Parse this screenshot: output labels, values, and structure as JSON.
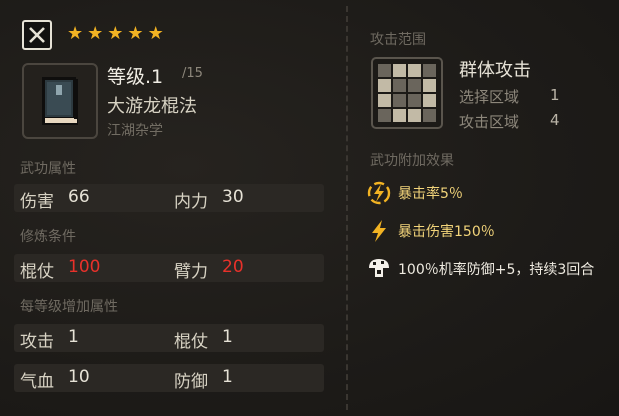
{
  "header": {
    "close_icon": "close-icon",
    "stars": [
      "★",
      "★",
      "★",
      "★",
      "★"
    ]
  },
  "skill": {
    "level": "等级.1",
    "level_max": "/15",
    "name": "大游龙棍法",
    "category": "江湖杂学"
  },
  "sections": {
    "attributes": "武功属性",
    "requirements": "修炼条件",
    "per_level": "每等级增加属性",
    "range": "攻击范围",
    "extra_effects": "武功附加效果"
  },
  "attributes": [
    {
      "label": "伤害",
      "value": "66"
    },
    {
      "label": "内力",
      "value": "30"
    }
  ],
  "requirements": [
    {
      "label": "棍仗",
      "value": "100"
    },
    {
      "label": "臂力",
      "value": "20"
    }
  ],
  "per_level": [
    {
      "label": "攻击",
      "value": "1"
    },
    {
      "label": "棍仗",
      "value": "1"
    },
    {
      "label": "气血",
      "value": "10"
    },
    {
      "label": "防御",
      "value": "1"
    }
  ],
  "range": {
    "type": "群体攻击",
    "select_label": "选择区域",
    "select_value": "1",
    "attack_label": "攻击区域",
    "attack_value": "4",
    "pattern": [
      0,
      1,
      1,
      0,
      1,
      0,
      0,
      1,
      1,
      0,
      0,
      1,
      0,
      1,
      1,
      0
    ]
  },
  "effects": [
    {
      "icon": "crit-rate-icon",
      "text": "暴击率5％"
    },
    {
      "icon": "lightning-icon",
      "text": "暴击伤害150％"
    },
    {
      "icon": "mushroom-icon",
      "text": "100％机率防御+5，持续3回合"
    }
  ],
  "colors": {
    "star": "#f2b323",
    "requirement_value": "#e8312a",
    "effect_text": "#f2d47a"
  }
}
